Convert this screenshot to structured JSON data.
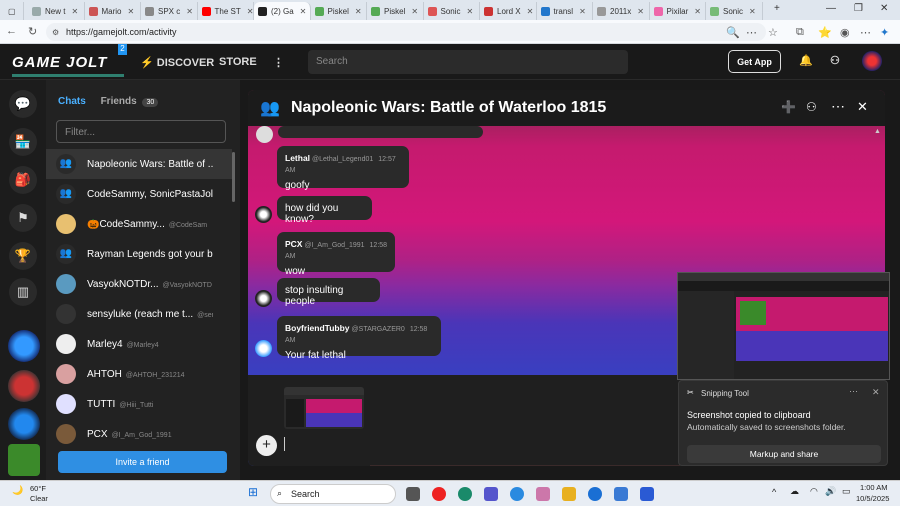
{
  "browser": {
    "tabs": [
      {
        "label": "New t",
        "color": "#9aa"
      },
      {
        "label": "Mario",
        "color": "#c55"
      },
      {
        "label": "SPX c",
        "color": "#888"
      },
      {
        "label": "The ST",
        "color": "#f00"
      },
      {
        "label": "(2) Ga",
        "color": "#222"
      },
      {
        "label": "Piskel",
        "color": "#5a5"
      },
      {
        "label": "Piskel",
        "color": "#5a5"
      },
      {
        "label": "Sonic",
        "color": "#d55"
      },
      {
        "label": "Lord X",
        "color": "#c33"
      },
      {
        "label": "transl",
        "color": "#27c"
      },
      {
        "label": "2011x",
        "color": "#999"
      },
      {
        "label": "Pixilar",
        "color": "#e6a"
      },
      {
        "label": "Sonic",
        "color": "#7b7"
      }
    ],
    "url": "https://gamejolt.com/activity"
  },
  "header": {
    "logo": "GAME JOLT",
    "badge": "2",
    "discover": "DISCOVER",
    "store": "STORE",
    "search_placeholder": "Search",
    "get_app": "Get App"
  },
  "sidebar": {
    "tab_chats": "Chats",
    "tab_friends": "Friends",
    "friends_count": "30",
    "filter_placeholder": "Filter...",
    "chats": [
      {
        "name": "Napoleonic Wars: Battle of ...",
        "sub": "",
        "group": true
      },
      {
        "name": "CodeSammy, SonicPastaJolt, ...",
        "sub": "",
        "group": true
      },
      {
        "name": "🎃CodeSammy...",
        "sub": "@CodeSam"
      },
      {
        "name": "Rayman Legends got your b...",
        "sub": "",
        "group": true
      },
      {
        "name": "VasyokNOTDr...",
        "sub": "@VasyokNOTD"
      },
      {
        "name": "sensyluke (reach me t...",
        "sub": "@sen"
      },
      {
        "name": "Marley4",
        "sub": "@Marley4"
      },
      {
        "name": "AHTOH",
        "sub": "@AHTOH_231214"
      },
      {
        "name": "TUTTI",
        "sub": "@Hiii_Tutti"
      },
      {
        "name": "PCX",
        "sub": "@I_Am_God_1991"
      }
    ],
    "invite": "Invite a friend"
  },
  "chat": {
    "title": "Napoleonic Wars: Battle of Waterloo 1815",
    "messages": [
      {
        "user": "Lethal",
        "handle": "@Lethal_Legend01",
        "time": "12:57 AM",
        "text": "goofy"
      },
      {
        "user": "",
        "handle": "",
        "time": "",
        "text": "how did you know?"
      },
      {
        "user": "PCX",
        "handle": "@I_Am_God_1991",
        "time": "12:58 AM",
        "text": "wow"
      },
      {
        "user": "",
        "handle": "",
        "time": "",
        "text": "stop insulting people"
      },
      {
        "user": "BoyfriendTubby",
        "handle": "@STARGAZER0",
        "time": "12:58 AM",
        "text": "Your fat lethal"
      }
    ]
  },
  "toast": {
    "app": "Snipping Tool",
    "title": "Screenshot copied to clipboard",
    "subtitle": "Automatically saved to screenshots folder.",
    "action": "Markup and share"
  },
  "taskbar": {
    "weather_temp": "60°F",
    "weather_text": "Clear",
    "search": "Search",
    "time": "1:00 AM",
    "date": "10/5/2025"
  }
}
